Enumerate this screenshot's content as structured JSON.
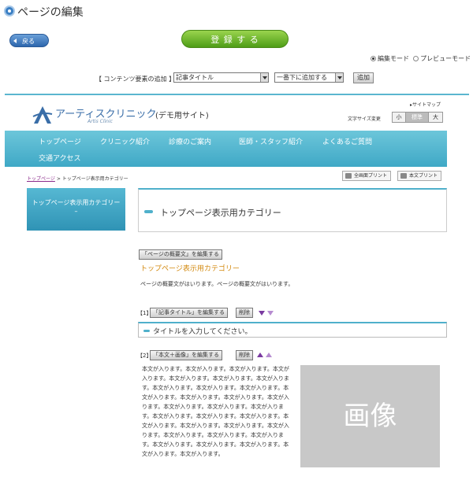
{
  "title": "ページの編集",
  "back_label": "戻る",
  "register_label": "登 録 す る",
  "modes": {
    "edit": "編集モード",
    "preview": "プレビューモード"
  },
  "add_content": {
    "label": "【 コンテンツ要素の追加 】",
    "type_selected": "記事タイトル",
    "position_selected": "一番下に追加する",
    "add_button": "追加"
  },
  "site": {
    "logo_name": "アーティスクリニック",
    "logo_sub": "Artis Clinic",
    "demo_label": "(デモ用サイト)",
    "sitemap": "サイトマップ",
    "font_size_label": "文字サイズ変更",
    "font_sizes": [
      "小",
      "標準",
      "大"
    ],
    "nav": [
      "トップページ",
      "クリニック紹介",
      "診療のご案内",
      "医師・スタッフ紹介",
      "よくあるご質問",
      "交通アクセス"
    ],
    "breadcrumb_link": "トップページ",
    "breadcrumb_current": "> トップページ表示用カテゴリー",
    "print_all": "全画面プリント",
    "print_body": "本文プリント",
    "side_category": "トップページ表示用カテゴリー",
    "main_heading": "トップページ表示用カテゴリー"
  },
  "summary": {
    "edit_button": "「ページの概要文」を編集する",
    "title": "トップページ表示用カテゴリー",
    "text": "ページの概要文がはいります。ページの概要文がはいります。"
  },
  "block1": {
    "index": "【1】",
    "edit_button": "「記事タイトル」を編集する",
    "delete_button": "削除",
    "title_text": "タイトルを入力してください。"
  },
  "block2": {
    "index": "【2】",
    "edit_button": "「本文＋画像」を編集する",
    "delete_button": "削除",
    "body_text": "本文が入ります。本文が入ります。本文が入ります。本文が入ります。本文が入ります。本文が入ります。本文が入ります。本文が入ります。本文が入ります。本文が入ります。本文が入ります。本文が入ります。本文が入ります。本文が入ります。本文が入ります。本文が入ります。本文が入ります。本文が入ります。本文が入ります。本文が入ります。本文が入ります。本文が入ります。本文が入ります。本文が入ります。本文が入ります。本文が入ります。本文が入ります。本文が入ります。本文が入ります。本文が入ります。本文が入ります。本文が入ります。",
    "image_label": "画像"
  }
}
